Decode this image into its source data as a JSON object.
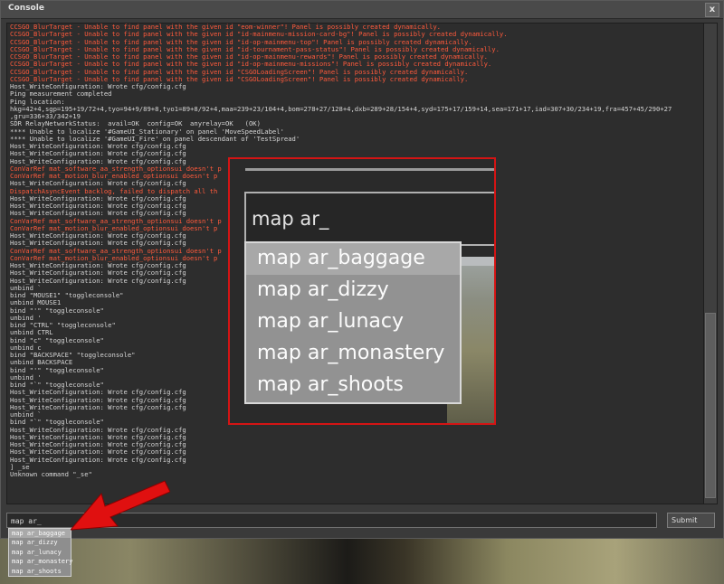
{
  "window": {
    "title": "Console",
    "close_glyph": "x"
  },
  "log_lines": [
    {
      "t": "CCSGO_BlurTarget - Unable to find panel with the given id \"eom-winner\"! Panel is possibly created dynamically.",
      "c": "e"
    },
    {
      "t": "CCSGO_BlurTarget - Unable to find panel with the given id \"id-mainmenu-mission-card-bg\"! Panel is possibly created dynamically.",
      "c": "e"
    },
    {
      "t": "CCSGO_BlurTarget - Unable to find panel with the given id \"id-op-mainmenu-top\"! Panel is possibly created dynamically.",
      "c": "e"
    },
    {
      "t": "CCSGO_BlurTarget - Unable to find panel with the given id \"id-tournament-pass-status\"! Panel is possibly created dynamically.",
      "c": "e"
    },
    {
      "t": "CCSGO_BlurTarget - Unable to find panel with the given id \"id-op-mainmenu-rewards\"! Panel is possibly created dynamically.",
      "c": "e"
    },
    {
      "t": "CCSGO_BlurTarget - Unable to find panel with the given id \"id-op-mainmenu-missions\"! Panel is possibly created dynamically.",
      "c": "e"
    },
    {
      "t": "CCSGO_BlurTarget - Unable to find panel with the given id \"CSGOLoadingScreen\"! Panel is possibly created dynamically.",
      "c": "e"
    },
    {
      "t": "CCSGO_BlurTarget - Unable to find panel with the given id \"CSGOLoadingScreen\"! Panel is possibly created dynamically.",
      "c": "e"
    },
    {
      "t": "Host_WriteConfiguration: Wrote cfg/config.cfg",
      "c": "n"
    },
    {
      "t": "Ping measurement completed",
      "c": "n"
    },
    {
      "t": "Ping location:",
      "c": "n"
    },
    {
      "t": "hkg=42+4,sgp=195+19/72+4,tyo=94+9/89+8,tyo1=89+8/92+4,maa=239+23/104+4,bom=278+27/128+4,dxb=289+28/154+4,syd=175+17/159+14,sea=171+17,iad=307+30/234+19,fra=457+45/290+27",
      "c": "n"
    },
    {
      "t": ",gru=336+33/342+19",
      "c": "n"
    },
    {
      "t": "SDR RelayNetworkStatus:  avail=OK  config=OK  anyrelay=OK   (OK)",
      "c": "n"
    },
    {
      "t": "**** Unable to localize '#GameUI_Stationary' on panel 'MoveSpeedLabel'",
      "c": "n"
    },
    {
      "t": "**** Unable to localize '#GameUI_Fire' on panel descendant of 'TestSpread'",
      "c": "n"
    },
    {
      "t": "Host_WriteConfiguration: Wrote cfg/config.cfg",
      "c": "n"
    },
    {
      "t": "Host_WriteConfiguration: Wrote cfg/config.cfg",
      "c": "n"
    },
    {
      "t": "Host_WriteConfiguration: Wrote cfg/config.cfg",
      "c": "n"
    },
    {
      "t": "ConVarRef mat_software_aa_strength_optionsui doesn't p",
      "c": "e"
    },
    {
      "t": "ConVarRef mat_motion_blur_enabled_optionsui doesn't p",
      "c": "e"
    },
    {
      "t": "Host_WriteConfiguration: Wrote cfg/config.cfg",
      "c": "n"
    },
    {
      "t": "DispatchAsyncEvent backlog, failed to dispatch all th",
      "c": "e"
    },
    {
      "t": "Host_WriteConfiguration: Wrote cfg/config.cfg",
      "c": "n"
    },
    {
      "t": "Host_WriteConfiguration: Wrote cfg/config.cfg",
      "c": "n"
    },
    {
      "t": "Host_WriteConfiguration: Wrote cfg/config.cfg",
      "c": "n"
    },
    {
      "t": "ConVarRef mat_software_aa_strength_optionsui doesn't p",
      "c": "e"
    },
    {
      "t": "ConVarRef mat_motion_blur_enabled_optionsui doesn't p",
      "c": "e"
    },
    {
      "t": "Host_WriteConfiguration: Wrote cfg/config.cfg",
      "c": "n"
    },
    {
      "t": "Host_WriteConfiguration: Wrote cfg/config.cfg",
      "c": "n"
    },
    {
      "t": "ConVarRef mat_software_aa_strength_optionsui doesn't p",
      "c": "e"
    },
    {
      "t": "ConVarRef mat_motion_blur_enabled_optionsui doesn't p",
      "c": "e"
    },
    {
      "t": "Host_WriteConfiguration: Wrote cfg/config.cfg",
      "c": "n"
    },
    {
      "t": "Host_WriteConfiguration: Wrote cfg/config.cfg",
      "c": "n"
    },
    {
      "t": "Host_WriteConfiguration: Wrote cfg/config.cfg",
      "c": "n"
    },
    {
      "t": "unbind `",
      "c": "n"
    },
    {
      "t": "bind \"MOUSE1\" \"toggleconsole\"",
      "c": "n"
    },
    {
      "t": "unbind MOUSE1",
      "c": "n"
    },
    {
      "t": "bind \"'\" \"toggleconsole\"",
      "c": "n"
    },
    {
      "t": "unbind '",
      "c": "n"
    },
    {
      "t": "bind \"CTRL\" \"toggleconsole\"",
      "c": "n"
    },
    {
      "t": "unbind CTRL",
      "c": "n"
    },
    {
      "t": "bind \"c\" \"toggleconsole\"",
      "c": "n"
    },
    {
      "t": "unbind c",
      "c": "n"
    },
    {
      "t": "bind \"BACKSPACE\" \"toggleconsole\"",
      "c": "n"
    },
    {
      "t": "unbind BACKSPACE",
      "c": "n"
    },
    {
      "t": "bind \"'\" \"toggleconsole\"",
      "c": "n"
    },
    {
      "t": "unbind '",
      "c": "n"
    },
    {
      "t": "bind \"`\" \"toggleconsole\"",
      "c": "n"
    },
    {
      "t": "Host_WriteConfiguration: Wrote cfg/config.cfg",
      "c": "n"
    },
    {
      "t": "Host_WriteConfiguration: Wrote cfg/config.cfg",
      "c": "n"
    },
    {
      "t": "Host_WriteConfiguration: Wrote cfg/config.cfg",
      "c": "n"
    },
    {
      "t": "unbind `",
      "c": "n"
    },
    {
      "t": "bind \"`\" \"toggleconsole\"",
      "c": "n"
    },
    {
      "t": "Host_WriteConfiguration: Wrote cfg/config.cfg",
      "c": "n"
    },
    {
      "t": "Host_WriteConfiguration: Wrote cfg/config.cfg",
      "c": "n"
    },
    {
      "t": "Host_WriteConfiguration: Wrote cfg/config.cfg",
      "c": "n"
    },
    {
      "t": "Host_WriteConfiguration: Wrote cfg/config.cfg",
      "c": "n"
    },
    {
      "t": "Host_WriteConfiguration: Wrote cfg/config.cfg",
      "c": "n"
    },
    {
      "t": "] _se",
      "c": "n"
    },
    {
      "t": "Unknown command \"_se\"",
      "c": "n"
    }
  ],
  "input": {
    "value": "map ar_"
  },
  "submit": {
    "label": "Submit"
  },
  "autocomplete": [
    "map ar_baggage",
    "map ar_dizzy",
    "map ar_lunacy",
    "map ar_monastery",
    "map ar_shoots"
  ],
  "colors": {
    "error": "#ff5a3c",
    "normal": "#d6d6d6",
    "callout_border": "#d41414",
    "arrow": "#e01010"
  },
  "annotation": {
    "arrow_icon": "red-arrow-icon",
    "callout": "zoomed-autocomplete-callout"
  }
}
